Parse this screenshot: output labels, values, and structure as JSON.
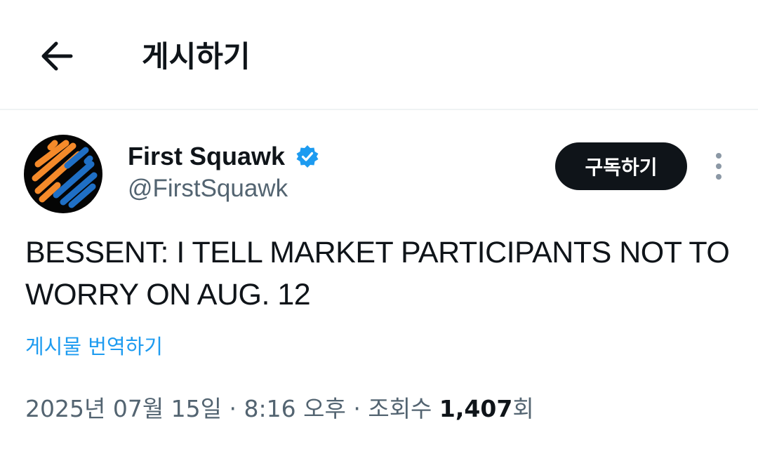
{
  "header": {
    "title": "게시하기",
    "back_icon": "arrow-left-icon"
  },
  "post": {
    "author": {
      "name": "First Squawk",
      "handle": "@FirstSquawk",
      "verified": true,
      "verified_color": "#1d9bf0",
      "avatar_icon": "first-squawk-logo",
      "avatar_colors": [
        "#f58a2a",
        "#1f6fc5"
      ]
    },
    "subscribe_label": "구독하기",
    "more_icon": "more-vertical-icon",
    "text": "BESSENT: I TELL MARKET PARTICIPANTS NOT TO WORRY ON AUG. 12",
    "translate_label": "게시물 번역하기",
    "meta": {
      "date": "2025년 07월 15일",
      "separator": " · ",
      "time": "8:16 오후",
      "views_label": "조회수",
      "views_count": "1,407",
      "views_suffix": "회"
    }
  },
  "colors": {
    "text_primary": "#0f1419",
    "text_secondary": "#536471",
    "accent": "#1d9bf0",
    "divider": "#eff3f4"
  }
}
